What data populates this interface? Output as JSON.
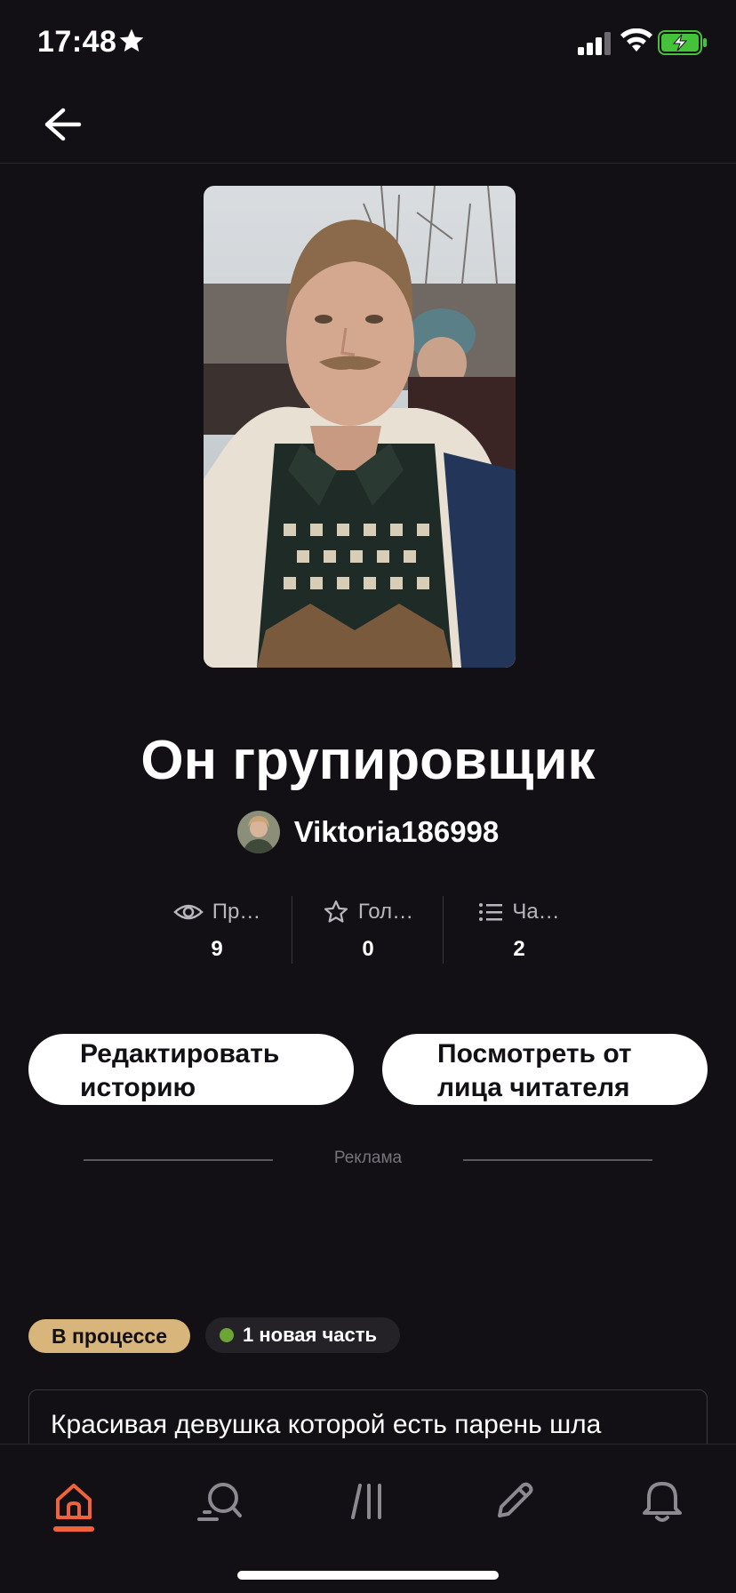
{
  "status_bar": {
    "time": "17:48"
  },
  "story": {
    "title": "Он групировщик",
    "author": "Viktoria186998"
  },
  "stats": [
    {
      "icon": "eye-icon",
      "label": "Пр…",
      "value": "9"
    },
    {
      "icon": "star-icon",
      "label": "Гол…",
      "value": "0"
    },
    {
      "icon": "list-icon",
      "label": "Ча…",
      "value": "2"
    }
  ],
  "actions": {
    "edit_line1": "Редактировать",
    "edit_line2": "историю",
    "preview_line1": "Посмотреть от",
    "preview_line2": "лица читателя"
  },
  "ad_label": "Реклама",
  "status_badge": "В процессе",
  "new_part_badge": "1 новая часть",
  "description": "Красивая девушка которой есть парень шла",
  "tab_bar": {
    "items": [
      "home-icon",
      "search-icon",
      "library-icon",
      "write-icon",
      "bell-icon"
    ],
    "active": "home-icon"
  },
  "colors": {
    "background": "#121014",
    "accent": "#f0623a",
    "status_pill": "#d8b57a",
    "new_dot": "#6aa536",
    "battery": "#44c23a"
  }
}
